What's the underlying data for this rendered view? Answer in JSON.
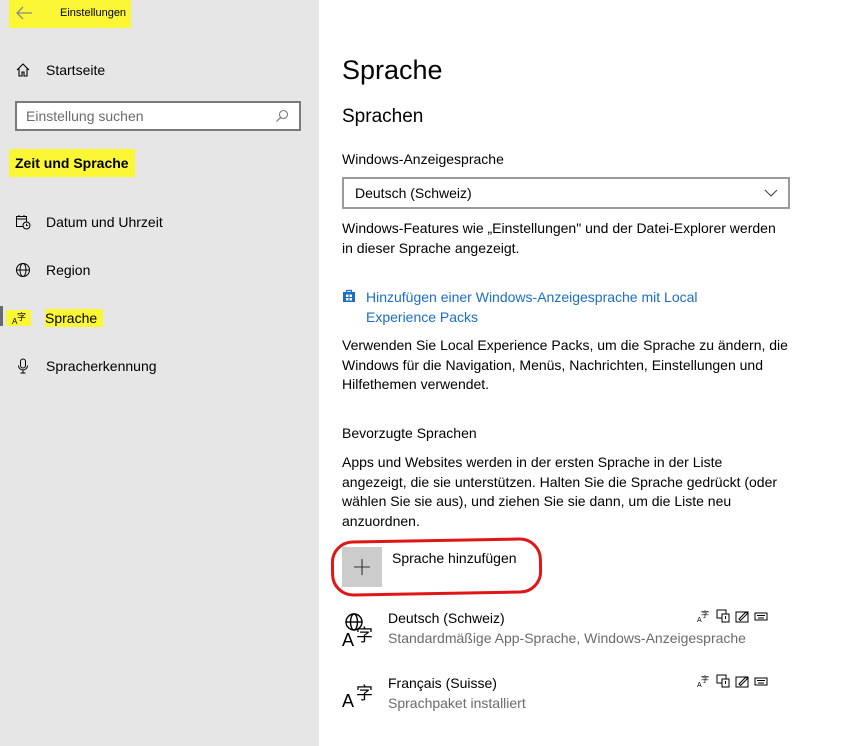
{
  "window": {
    "title": "Einstellungen"
  },
  "sidebar": {
    "home_label": "Startseite",
    "search_placeholder": "Einstellung suchen",
    "section_title": "Zeit und Sprache",
    "items": [
      {
        "label": "Datum und Uhrzeit",
        "icon": "calendar-clock-icon"
      },
      {
        "label": "Region",
        "icon": "globe-icon"
      },
      {
        "label": "Sprache",
        "icon": "language-icon",
        "active": true
      },
      {
        "label": "Spracherkennung",
        "icon": "microphone-icon"
      }
    ]
  },
  "main": {
    "title": "Sprache",
    "subtitle": "Sprachen",
    "display_language": {
      "label": "Windows-Anzeigesprache",
      "selected": "Deutsch (Schweiz)",
      "description": "Windows-Features wie „Einstellungen\" und der Datei-Explorer werden in dieser Sprache angezeigt."
    },
    "lxp_link": "Hinzufügen einer Windows-Anzeigesprache mit Local Experience Packs",
    "lxp_description": "Verwenden Sie Local Experience Packs, um die Sprache zu ändern, die Windows für die Navigation, Menüs, Nachrichten, Einstellungen und Hilfethemen verwendet.",
    "preferred": {
      "label": "Bevorzugte Sprachen",
      "description": "Apps und Websites werden in der ersten Sprache in der Liste angezeigt, die sie unterstützen. Halten Sie die Sprache gedrückt (oder wählen Sie sie aus), und ziehen Sie sie dann, um die Liste neu anzuordnen.",
      "add_label": "Sprache hinzufügen",
      "languages": [
        {
          "name": "Deutsch (Schweiz)",
          "detail": "Standardmäßige App-Sprache, Windows-Anzeigesprache"
        },
        {
          "name": "Français (Suisse)",
          "detail": "Sprachpaket installiert"
        }
      ]
    }
  },
  "colors": {
    "highlight": "#fbf735",
    "link": "#1a6ec7",
    "annotation": "#e01616",
    "sidebar_bg": "#e6e6e6"
  }
}
